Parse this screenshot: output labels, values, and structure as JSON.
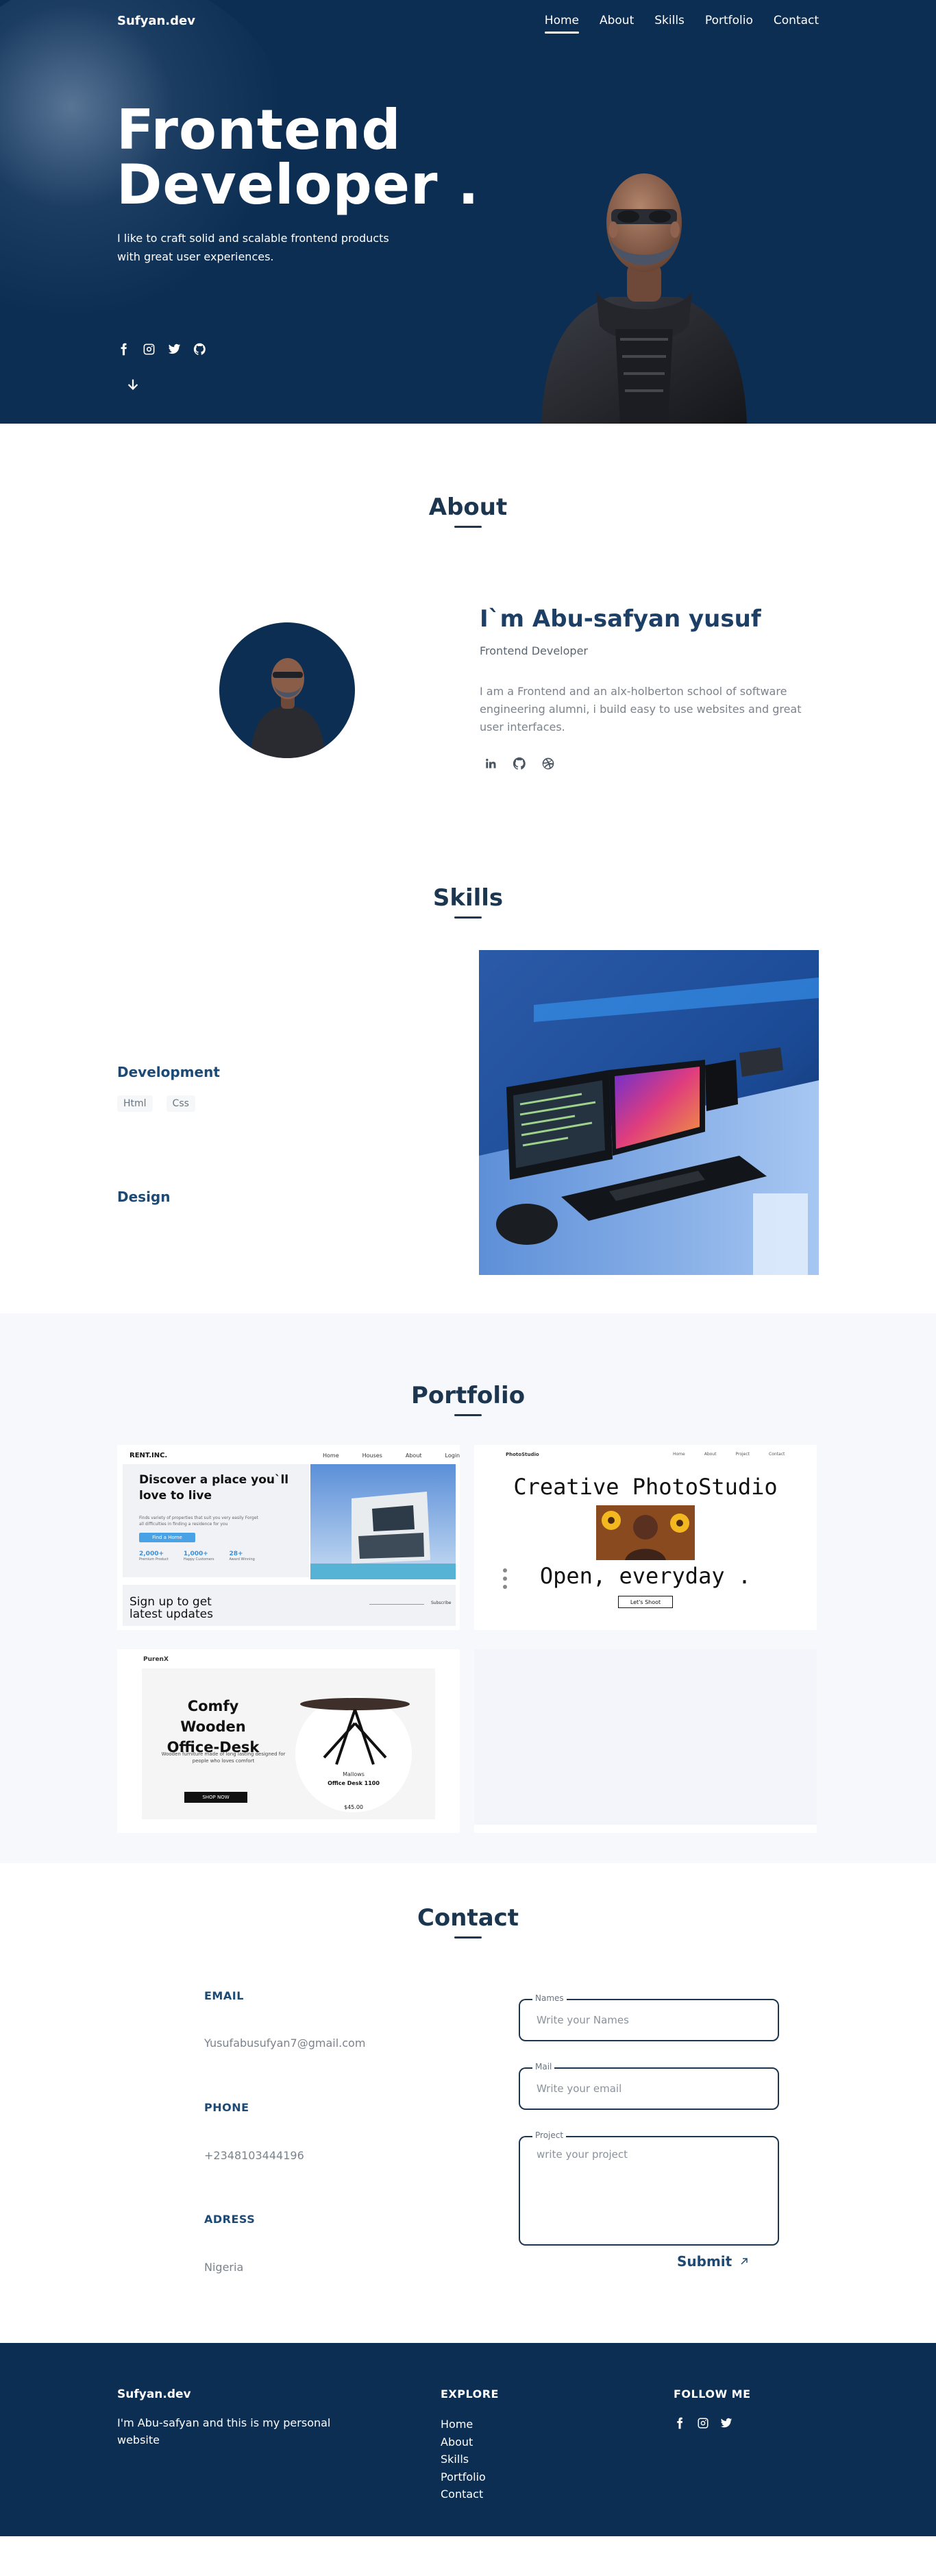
{
  "nav": {
    "brand": "Sufyan.dev",
    "items": [
      "Home",
      "About",
      "Skills",
      "Portfolio",
      "Contact"
    ],
    "active": "Home"
  },
  "hero": {
    "title_line1": "Frontend",
    "title_line2": "Developer .",
    "tagline": "I like to craft solid and scalable frontend products with great user experiences.",
    "socials": [
      "facebook-icon",
      "instagram-icon",
      "twitter-icon",
      "github-icon"
    ]
  },
  "about": {
    "title": "About",
    "name": "I`m Abu-safyan yusuf",
    "role": "Frontend Developer",
    "description": "I am a Frontend and an alx-holberton school of software engineering alumni, i build easy to use websites and great user interfaces.",
    "socials": [
      "linkedin-icon",
      "github-icon",
      "dribbble-icon"
    ]
  },
  "skills": {
    "title": "Skills",
    "development_label": "Development",
    "development_tags": [
      "Html",
      "Css"
    ],
    "design_label": "Design"
  },
  "portfolio": {
    "title": "Portfolio",
    "p1": {
      "brand": "RENT.INC.",
      "nav": [
        "Home",
        "Houses",
        "About"
      ],
      "login": "Login",
      "heading_line1": "Discover a place you`ll",
      "heading_line2": "love to live",
      "body": "Finds variety of properties that suit you very easily Forget all difficulties in finding a residence for you",
      "cta": "Find a Home",
      "stats": [
        {
          "value": "2,000+",
          "label": "Premium Product"
        },
        {
          "value": "1,000+",
          "label": "Happy Customers"
        },
        {
          "value": "28+",
          "label": "Award Winning"
        }
      ],
      "footer_heading": "Sign up to get latest updates",
      "subscribe": "Subscribe"
    },
    "p2": {
      "brand": "PhotoStudio",
      "nav": [
        "Home",
        "About",
        "Project",
        "Contact"
      ],
      "heading": "Creative PhotoStudio",
      "sub": "Open, everyday .",
      "cta": "Let's Shoot"
    },
    "p3": {
      "brand": "PurenX",
      "heading_line1": "Comfy Wooden",
      "heading_line2": "Office-Desk",
      "body": "Wooden furniture made of long lasting designed for people who loves comfort",
      "cta": "SHOP NOW",
      "product_brand": "Mallows",
      "product_name": "Office Desk 1100",
      "price": "$45.00"
    }
  },
  "contact": {
    "title": "Contact",
    "email_label": "EMAIL",
    "email": "Yusufabusufyan7@gmail.com",
    "phone_label": "PHONE",
    "phone": "+2348103444196",
    "address_label": "ADRESS",
    "address": "Nigeria",
    "form": {
      "names_label": "Names",
      "names_placeholder": "Write your Names",
      "mail_label": "Mail",
      "mail_placeholder": "Write your email",
      "project_label": "Project",
      "project_placeholder": "write your project"
    },
    "submit": "Submit"
  },
  "footer": {
    "brand": "Sufyan.dev",
    "description": "I'm Abu-safyan and this is my personal website",
    "explore_heading": "EXPLORE",
    "links": [
      "Home",
      "About",
      "Skills",
      "Portfolio",
      "Contact"
    ],
    "follow_heading": "FOLLOW ME",
    "socials": [
      "facebook-icon",
      "instagram-icon",
      "twitter-icon"
    ]
  }
}
